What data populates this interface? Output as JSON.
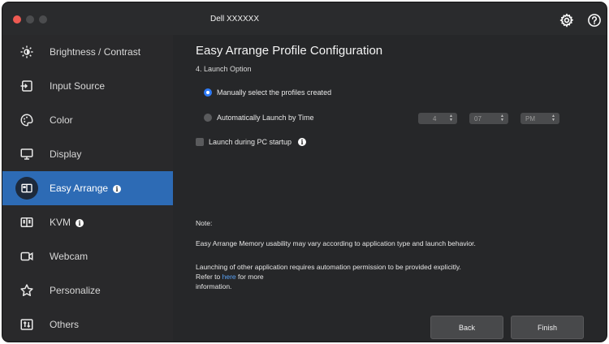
{
  "app": {
    "title": "Dell XXXXXX"
  },
  "titlebar": {
    "settings_icon": "gear-icon",
    "help_icon": "help-circle-icon"
  },
  "sidebar": {
    "items": [
      {
        "label": "Brightness / Contrast",
        "icon": "sun-icon"
      },
      {
        "label": "Input Source",
        "icon": "input-arrow-icon"
      },
      {
        "label": "Color",
        "icon": "palette-icon"
      },
      {
        "label": "Display",
        "icon": "monitor-icon"
      },
      {
        "label": "Easy Arrange",
        "icon": "layout-icon",
        "active": true,
        "info": true
      },
      {
        "label": "KVM",
        "icon": "kvm-icon",
        "info": true
      },
      {
        "label": "Webcam",
        "icon": "webcam-icon"
      },
      {
        "label": "Personalize",
        "icon": "star-icon"
      },
      {
        "label": "Others",
        "icon": "others-icon"
      }
    ],
    "active_color": "#2d6bb5"
  },
  "main": {
    "title": "Easy Arrange Profile Configuration",
    "step": "4. Launch Option",
    "option_manual": "Manually select the profiles created",
    "option_auto": "Automatically Launch by Time",
    "selected_option": "manual",
    "time": {
      "hour": "4",
      "minute": "07",
      "period": "PM"
    },
    "launch_startup_label": "Launch during PC startup",
    "launch_startup_checked": false,
    "note_heading": "Note:",
    "note_1": "Easy Arrange Memory usability may vary according to application type and launch behavior.",
    "note_2": "Launching of other application requires automation permission to be provided explicitly.",
    "note_refer_prefix": "Refer to",
    "note_link": "here",
    "note_refer_suffix": "for more",
    "note_refer_end": "information.",
    "back_label": "Back",
    "finish_label": "Finish"
  },
  "colors": {
    "accent": "#2f7bf5",
    "link": "#5aa2f5",
    "close": "#ee5a52"
  }
}
